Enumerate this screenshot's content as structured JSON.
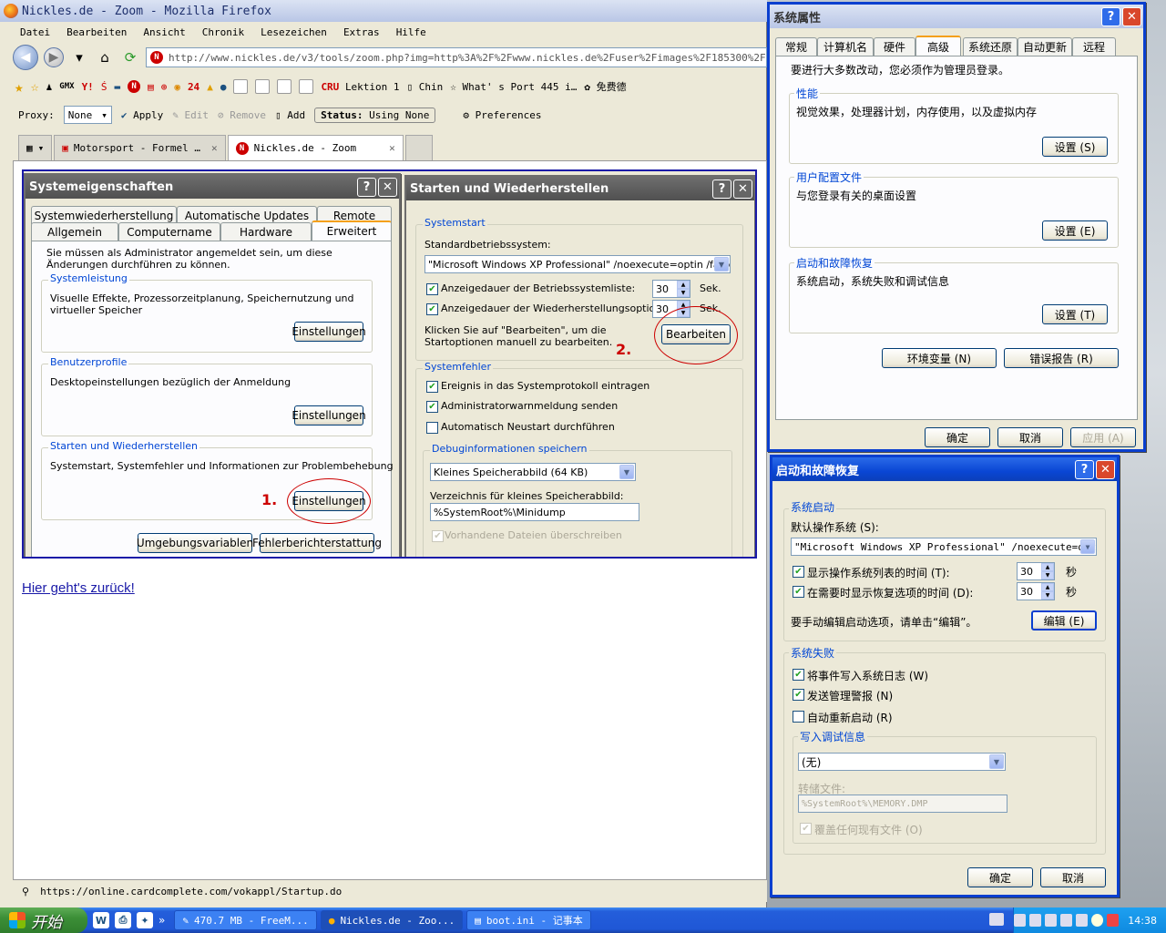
{
  "firefox": {
    "title": "Nickles.de - Zoom - Mozilla Firefox",
    "menu": [
      "Datei",
      "Bearbeiten",
      "Ansicht",
      "Chronik",
      "Lesezeichen",
      "Extras",
      "Hilfe"
    ],
    "url": "http://www.nickles.de/v3/tools/zoom.php?img=http%3A%2F%2Fwww.nickles.de%2Fuser%2Fimages%2F185300%2Fboot.ini-bea",
    "bookmarks": [
      "Lektion 1",
      "Chin",
      "What' s Port 445 i…",
      "免费德"
    ],
    "proxy_label": "Proxy:",
    "proxy_value": "None",
    "apply": "Apply",
    "edit": "Edit",
    "remove": "Remove",
    "add": "Add",
    "status_label": "Status:",
    "status_value": "Using None",
    "preferences": "Preferences",
    "tabs": [
      "Motorsport - Formel …",
      "Nickles.de - Zoom"
    ],
    "link": "Hier geht's zurück!",
    "statusbar": "https://online.cardcomplete.com/vokappl/Startup.do"
  },
  "de_sys": {
    "title": "Systemeigenschaften",
    "tabs_row1": [
      "Systemwiederherstellung",
      "Automatische Updates",
      "Remote"
    ],
    "tabs_row2": [
      "Allgemein",
      "Computername",
      "Hardware",
      "Erweitert"
    ],
    "admin_note": "Sie müssen als Administrator angemeldet sein, um diese Änderungen durchführen zu können.",
    "perf_label": "Systemleistung",
    "perf_text": "Visuelle Effekte, Prozessorzeitplanung, Speichernutzung und virtueller Speicher",
    "profile_label": "Benutzerprofile",
    "profile_text": "Desktopeinstellungen bezüglich der Anmeldung",
    "startup_label": "Starten und Wiederherstellen",
    "startup_text": "Systemstart, Systemfehler und Informationen zur Problembehebung",
    "settings": "Einstellungen",
    "env": "Umgebungsvariablen",
    "errreport": "Fehlerberichterstattung",
    "mark1": "1."
  },
  "de_startup": {
    "title": "Starten und Wiederherstellen",
    "systemstart": "Systemstart",
    "default_os_label": "Standardbetriebssystem:",
    "default_os": "\"Microsoft Windows XP Professional\" /noexecute=optin /fastdetect",
    "show_list": "Anzeigedauer der Betriebssystemliste:",
    "show_recovery": "Anzeigedauer der Wiederherstellungsoptionen:",
    "sec": "Sek.",
    "val1": "30",
    "val2": "30",
    "edit_note": "Klicken Sie auf \"Bearbeiten\", um die Startoptionen manuell zu bearbeiten.",
    "edit_btn": "Bearbeiten",
    "mark2": "2.",
    "sysfail": "Systemfehler",
    "log_event": "Ereignis in das Systemprotokoll eintragen",
    "admin_alert": "Administratorwarnmeldung senden",
    "auto_restart": "Automatisch Neustart durchführen",
    "debug_label": "Debuginformationen speichern",
    "dump_type": "Kleines Speicherabbild (64 KB)",
    "dump_dir_label": "Verzeichnis für kleines Speicherabbild:",
    "dump_dir": "%SystemRoot%\\Minidump",
    "overwrite": "Vorhandene Dateien überschreiben"
  },
  "cn_sys": {
    "title": "系统属性",
    "tabs": [
      "常规",
      "计算机名",
      "硬件",
      "高级",
      "系统还原",
      "自动更新",
      "远程"
    ],
    "admin_note": "要进行大多数改动，您必须作为管理员登录。",
    "perf_label": "性能",
    "perf_text": "视觉效果，处理器计划，内存使用，以及虚拟内存",
    "perf_btn": "设置 (S)",
    "profile_label": "用户配置文件",
    "profile_text": "与您登录有关的桌面设置",
    "profile_btn": "设置 (E)",
    "startup_label": "启动和故障恢复",
    "startup_text": "系统启动，系统失败和调试信息",
    "startup_btn": "设置 (T)",
    "env": "环境变量 (N)",
    "errreport": "错误报告 (R)",
    "ok": "确定",
    "cancel": "取消",
    "apply": "应用 (A)"
  },
  "cn_startup": {
    "title": "启动和故障恢复",
    "systemstart": "系统启动",
    "default_os_label": "默认操作系统 (S):",
    "default_os": "\"Microsoft Windows XP Professional\" /noexecute=optin",
    "show_list": "显示操作系统列表的时间 (T):",
    "show_recovery": "在需要时显示恢复选项的时间 (D):",
    "sec": "秒",
    "val1": "30",
    "val2": "30",
    "edit_note": "要手动编辑启动选项，请单击“编辑”。",
    "edit_btn": "编辑 (E)",
    "sysfail": "系统失败",
    "log_event": "将事件写入系统日志 (W)",
    "admin_alert": "发送管理警报 (N)",
    "auto_restart": "自动重新启动 (R)",
    "debug_label": "写入调试信息",
    "dump_type": "(无)",
    "dump_file_label": "转储文件:",
    "dump_file": "%SystemRoot%\\MEMORY.DMP",
    "overwrite": "覆盖任何现有文件 (O)",
    "ok": "确定",
    "cancel": "取消"
  },
  "taskbar": {
    "start": "开始",
    "tasks": [
      "470.7 MB - FreeM...",
      "Nickles.de - Zoo...",
      "boot.ini - 记事本"
    ],
    "clock": "14:38"
  }
}
